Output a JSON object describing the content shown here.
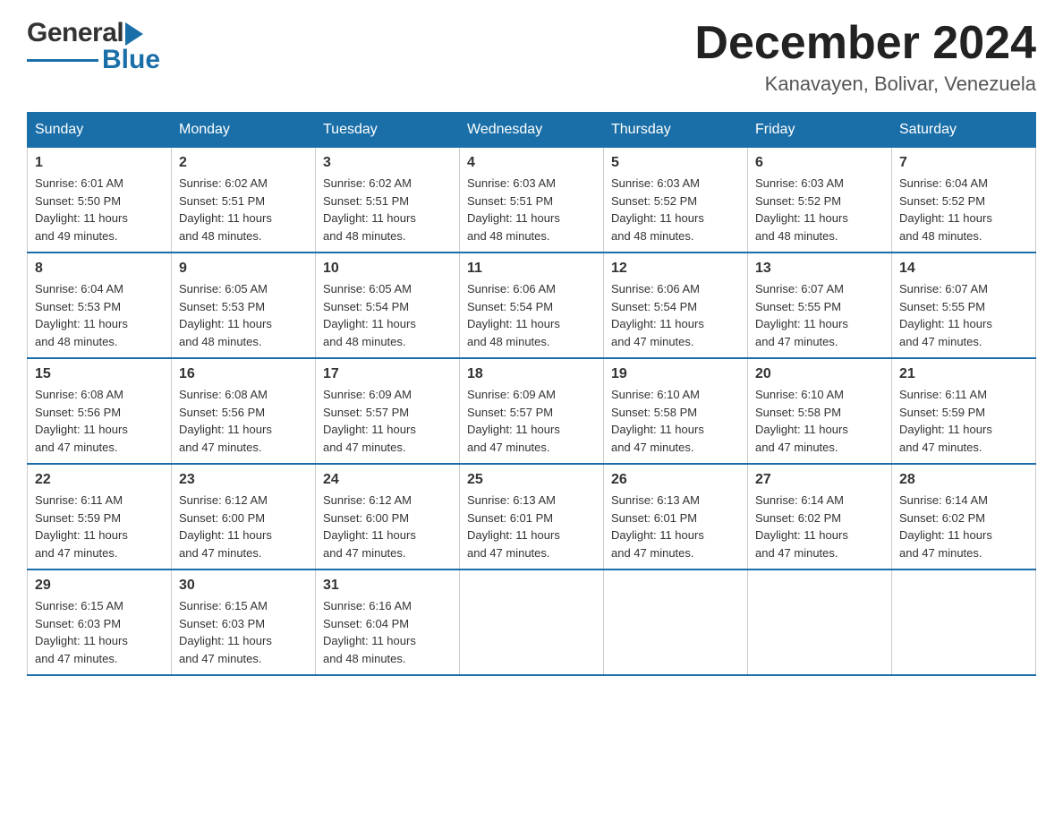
{
  "header": {
    "logo_general": "General",
    "logo_blue": "Blue",
    "month_title": "December 2024",
    "location": "Kanavayen, Bolivar, Venezuela"
  },
  "weekdays": [
    "Sunday",
    "Monday",
    "Tuesday",
    "Wednesday",
    "Thursday",
    "Friday",
    "Saturday"
  ],
  "weeks": [
    [
      {
        "day": "1",
        "sunrise": "6:01 AM",
        "sunset": "5:50 PM",
        "daylight": "11 hours and 49 minutes."
      },
      {
        "day": "2",
        "sunrise": "6:02 AM",
        "sunset": "5:51 PM",
        "daylight": "11 hours and 48 minutes."
      },
      {
        "day": "3",
        "sunrise": "6:02 AM",
        "sunset": "5:51 PM",
        "daylight": "11 hours and 48 minutes."
      },
      {
        "day": "4",
        "sunrise": "6:03 AM",
        "sunset": "5:51 PM",
        "daylight": "11 hours and 48 minutes."
      },
      {
        "day": "5",
        "sunrise": "6:03 AM",
        "sunset": "5:52 PM",
        "daylight": "11 hours and 48 minutes."
      },
      {
        "day": "6",
        "sunrise": "6:03 AM",
        "sunset": "5:52 PM",
        "daylight": "11 hours and 48 minutes."
      },
      {
        "day": "7",
        "sunrise": "6:04 AM",
        "sunset": "5:52 PM",
        "daylight": "11 hours and 48 minutes."
      }
    ],
    [
      {
        "day": "8",
        "sunrise": "6:04 AM",
        "sunset": "5:53 PM",
        "daylight": "11 hours and 48 minutes."
      },
      {
        "day": "9",
        "sunrise": "6:05 AM",
        "sunset": "5:53 PM",
        "daylight": "11 hours and 48 minutes."
      },
      {
        "day": "10",
        "sunrise": "6:05 AM",
        "sunset": "5:54 PM",
        "daylight": "11 hours and 48 minutes."
      },
      {
        "day": "11",
        "sunrise": "6:06 AM",
        "sunset": "5:54 PM",
        "daylight": "11 hours and 48 minutes."
      },
      {
        "day": "12",
        "sunrise": "6:06 AM",
        "sunset": "5:54 PM",
        "daylight": "11 hours and 47 minutes."
      },
      {
        "day": "13",
        "sunrise": "6:07 AM",
        "sunset": "5:55 PM",
        "daylight": "11 hours and 47 minutes."
      },
      {
        "day": "14",
        "sunrise": "6:07 AM",
        "sunset": "5:55 PM",
        "daylight": "11 hours and 47 minutes."
      }
    ],
    [
      {
        "day": "15",
        "sunrise": "6:08 AM",
        "sunset": "5:56 PM",
        "daylight": "11 hours and 47 minutes."
      },
      {
        "day": "16",
        "sunrise": "6:08 AM",
        "sunset": "5:56 PM",
        "daylight": "11 hours and 47 minutes."
      },
      {
        "day": "17",
        "sunrise": "6:09 AM",
        "sunset": "5:57 PM",
        "daylight": "11 hours and 47 minutes."
      },
      {
        "day": "18",
        "sunrise": "6:09 AM",
        "sunset": "5:57 PM",
        "daylight": "11 hours and 47 minutes."
      },
      {
        "day": "19",
        "sunrise": "6:10 AM",
        "sunset": "5:58 PM",
        "daylight": "11 hours and 47 minutes."
      },
      {
        "day": "20",
        "sunrise": "6:10 AM",
        "sunset": "5:58 PM",
        "daylight": "11 hours and 47 minutes."
      },
      {
        "day": "21",
        "sunrise": "6:11 AM",
        "sunset": "5:59 PM",
        "daylight": "11 hours and 47 minutes."
      }
    ],
    [
      {
        "day": "22",
        "sunrise": "6:11 AM",
        "sunset": "5:59 PM",
        "daylight": "11 hours and 47 minutes."
      },
      {
        "day": "23",
        "sunrise": "6:12 AM",
        "sunset": "6:00 PM",
        "daylight": "11 hours and 47 minutes."
      },
      {
        "day": "24",
        "sunrise": "6:12 AM",
        "sunset": "6:00 PM",
        "daylight": "11 hours and 47 minutes."
      },
      {
        "day": "25",
        "sunrise": "6:13 AM",
        "sunset": "6:01 PM",
        "daylight": "11 hours and 47 minutes."
      },
      {
        "day": "26",
        "sunrise": "6:13 AM",
        "sunset": "6:01 PM",
        "daylight": "11 hours and 47 minutes."
      },
      {
        "day": "27",
        "sunrise": "6:14 AM",
        "sunset": "6:02 PM",
        "daylight": "11 hours and 47 minutes."
      },
      {
        "day": "28",
        "sunrise": "6:14 AM",
        "sunset": "6:02 PM",
        "daylight": "11 hours and 47 minutes."
      }
    ],
    [
      {
        "day": "29",
        "sunrise": "6:15 AM",
        "sunset": "6:03 PM",
        "daylight": "11 hours and 47 minutes."
      },
      {
        "day": "30",
        "sunrise": "6:15 AM",
        "sunset": "6:03 PM",
        "daylight": "11 hours and 47 minutes."
      },
      {
        "day": "31",
        "sunrise": "6:16 AM",
        "sunset": "6:04 PM",
        "daylight": "11 hours and 48 minutes."
      },
      null,
      null,
      null,
      null
    ]
  ],
  "labels": {
    "sunrise": "Sunrise:",
    "sunset": "Sunset:",
    "daylight": "Daylight:"
  }
}
